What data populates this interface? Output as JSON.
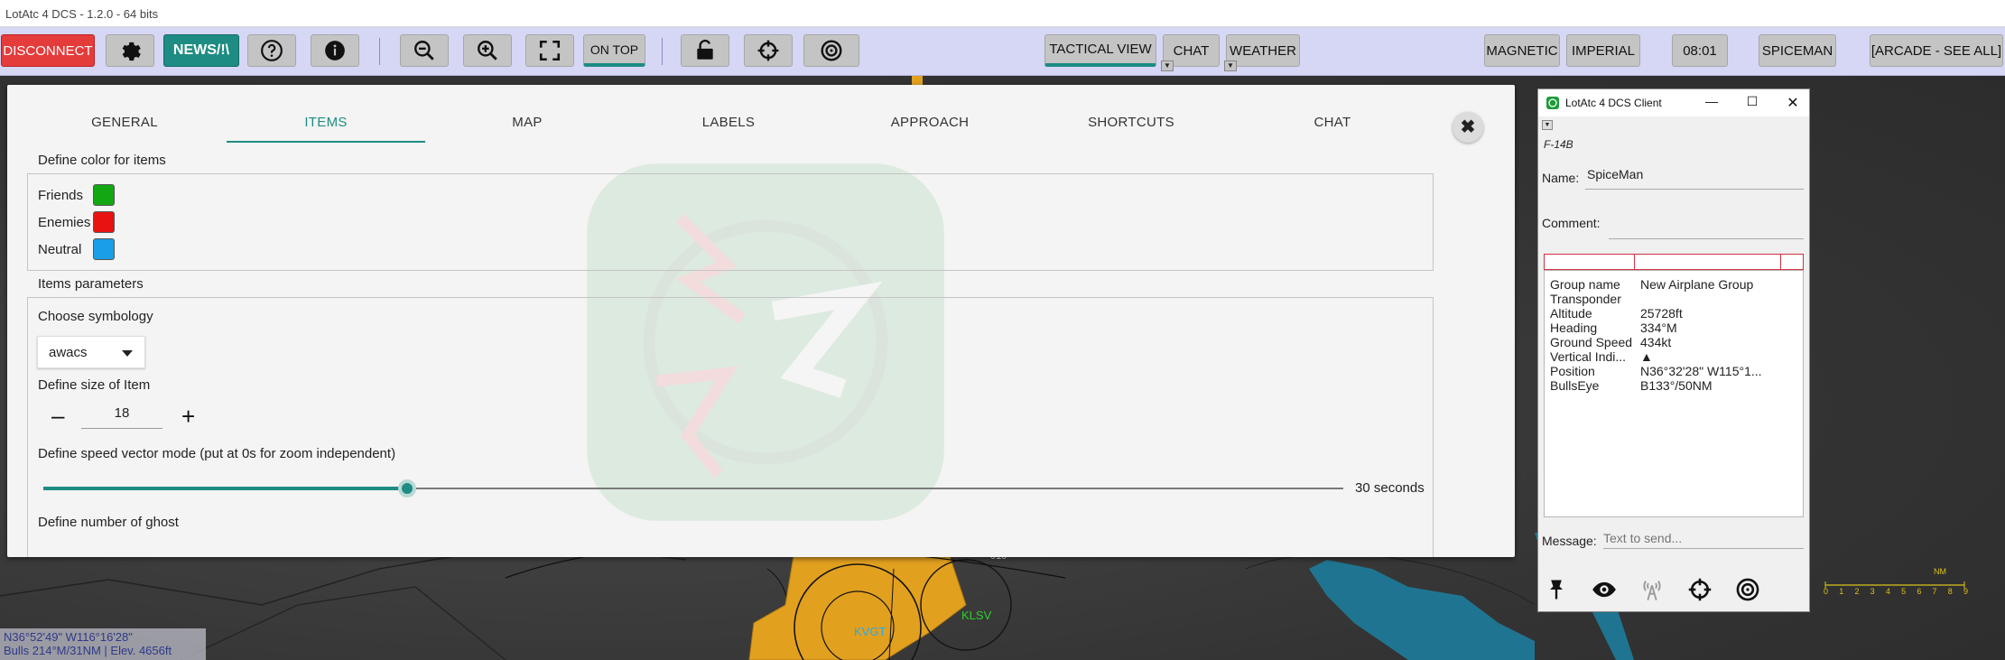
{
  "window": {
    "title": "LotAtc 4 DCS - 1.2.0 - 64 bits"
  },
  "toolbar": {
    "disconnect": "DISCONNECT",
    "news": "NEWS/!\\",
    "on_top": "ON TOP",
    "tactical_view": "TACTICAL VIEW",
    "chat": "CHAT",
    "weather": "WEATHER",
    "magnetic": "MAGNETIC",
    "imperial": "IMPERIAL",
    "time": "08:01",
    "user": "SPICEMAN",
    "mode": "[ARCADE - SEE ALL]"
  },
  "settings": {
    "tabs": [
      "GENERAL",
      "ITEMS",
      "MAP",
      "LABELS",
      "APPROACH",
      "SHORTCUTS",
      "CHAT"
    ],
    "active_tab": "ITEMS",
    "close_label": "✖",
    "color_section": "Define color for items",
    "colors": [
      {
        "label": "Friends",
        "color": "#13a813"
      },
      {
        "label": "Enemies",
        "color": "#e81212"
      },
      {
        "label": "Neutral",
        "color": "#1a9ee8"
      }
    ],
    "params_section": "Items parameters",
    "symbology_label": "Choose symbology",
    "symbology_value": "awacs",
    "size_label": "Define size of Item",
    "size_minus": "–",
    "size_value": "18",
    "size_plus": "+",
    "speed_vector_label": "Define speed vector mode (put at 0s for zoom independent)",
    "speed_vector_fraction": 0.28,
    "speed_vector_value": "30 seconds",
    "ghost_label": "Define number of ghost"
  },
  "client": {
    "title": "LotAtc 4 DCS Client",
    "aircraft": "F-14B",
    "name_label": "Name:",
    "name_value": "SpiceMan",
    "comment_label": "Comment:",
    "message_label": "Message:",
    "message_placeholder": "Text to send...",
    "info": [
      {
        "key": "Group name",
        "value": "New Airplane Group"
      },
      {
        "key": "Transponder",
        "value": ""
      },
      {
        "key": "Altitude",
        "value": "25728ft"
      },
      {
        "key": "Heading",
        "value": "334°M"
      },
      {
        "key": "Ground Speed",
        "value": "434kt"
      },
      {
        "key": "Vertical Indi...",
        "value": "▲"
      },
      {
        "key": "Position",
        "value": "N36°32'28\" W115°1..."
      },
      {
        "key": "BullsEye",
        "value": "B133°/50NM"
      }
    ]
  },
  "map": {
    "airfields": [
      "KVGT",
      "KLSV"
    ],
    "alt_label": "010",
    "scale_unit": "NM",
    "scale_ticks": [
      "0",
      "1",
      "2",
      "3",
      "4",
      "5",
      "6",
      "7",
      "8",
      "9"
    ]
  },
  "status": {
    "coords": "N36°52'49\" W116°16'28\"",
    "bulls": "Bulls 214°M/31NM | Elev. 4656ft"
  }
}
